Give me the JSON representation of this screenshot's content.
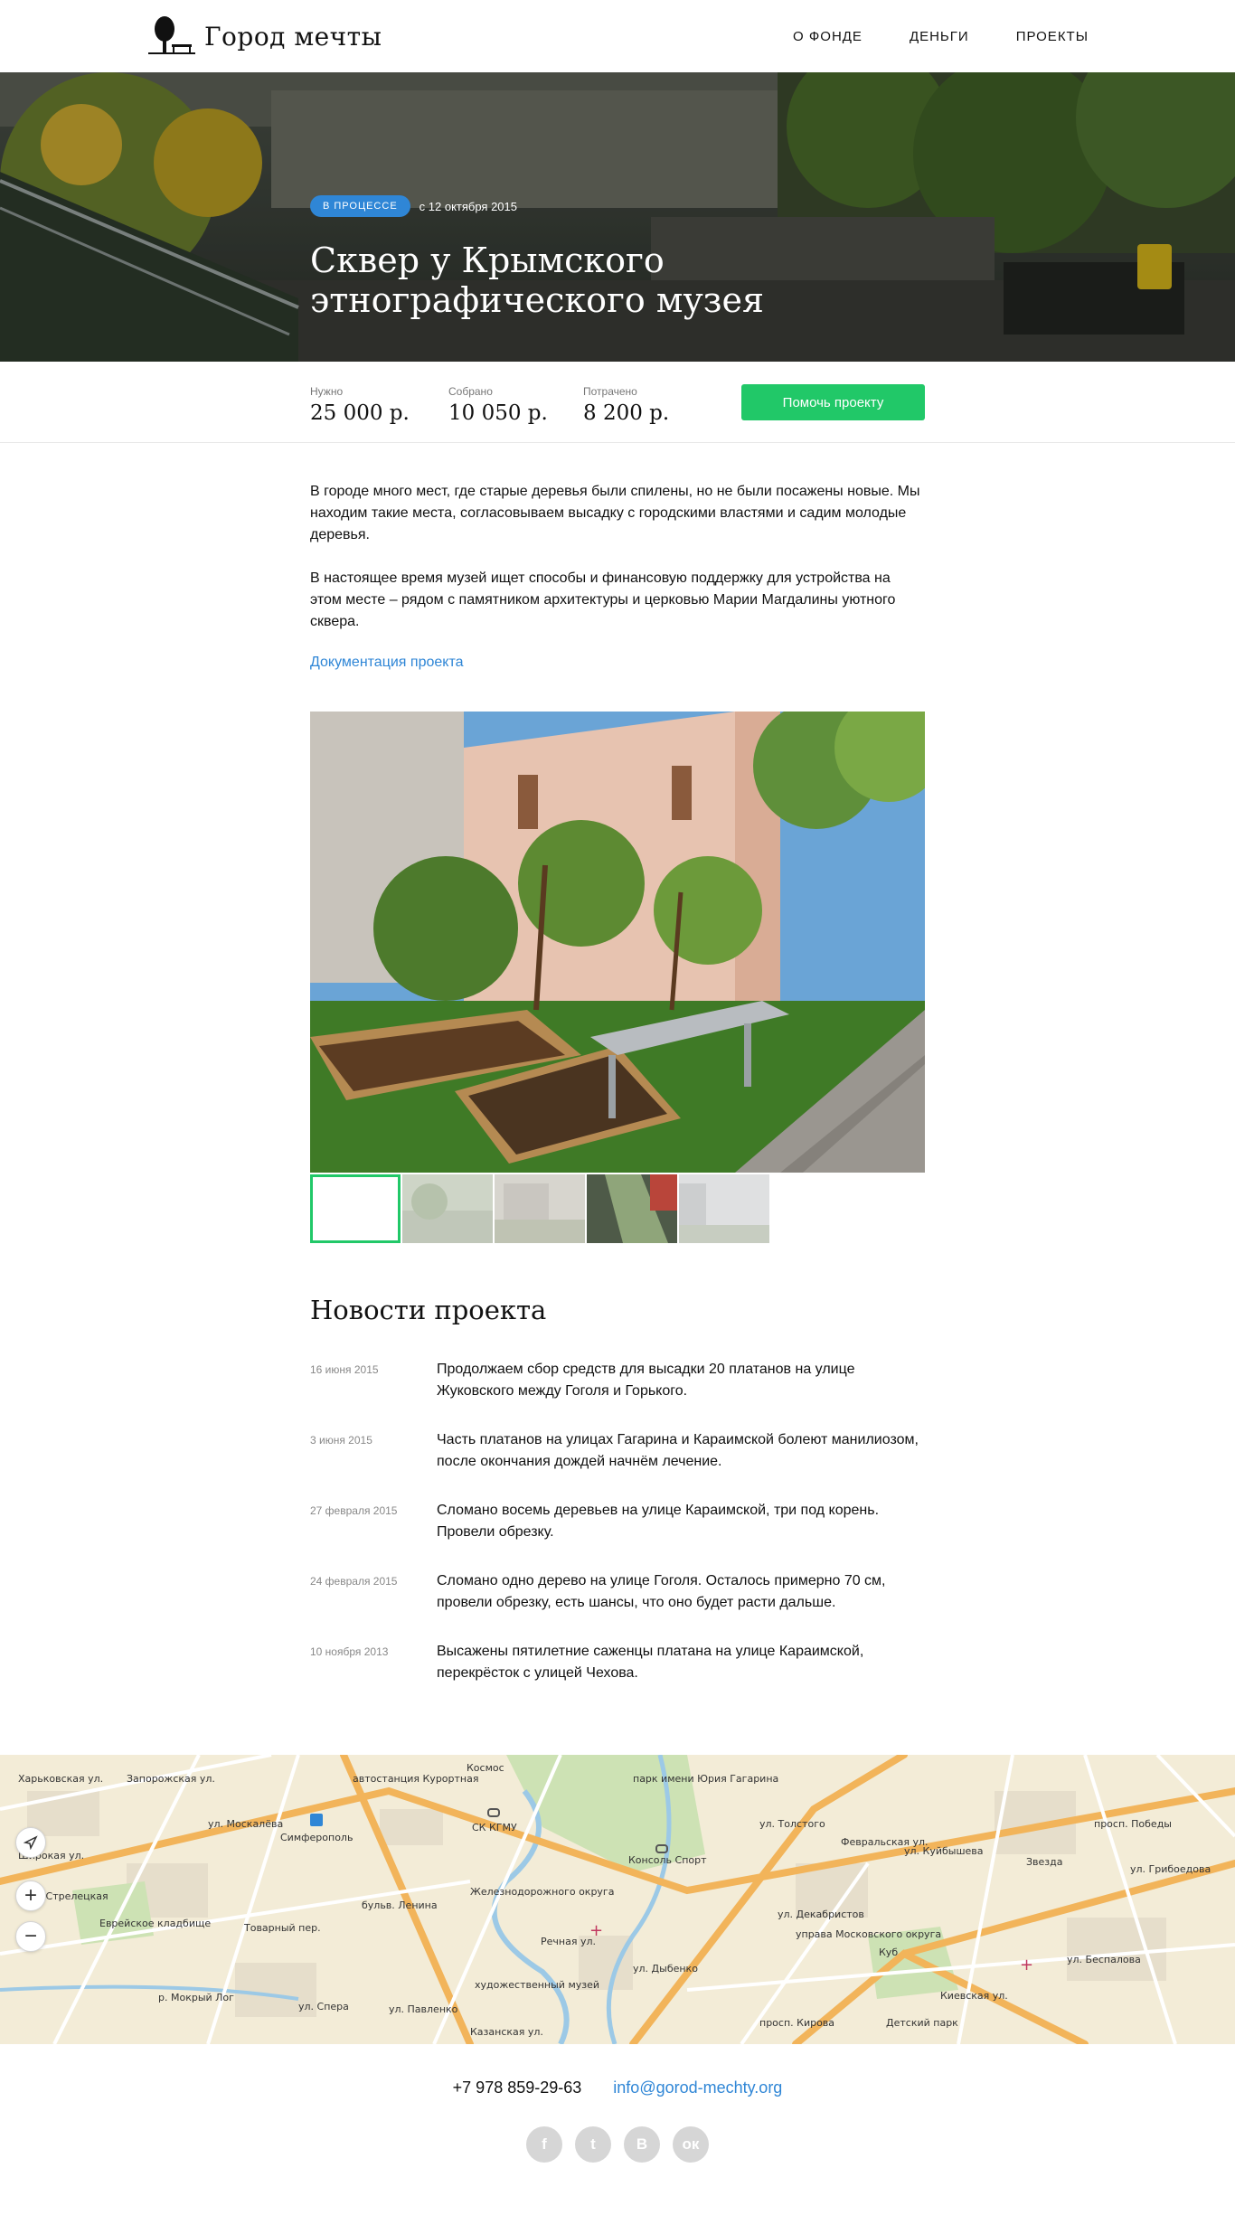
{
  "header": {
    "logo_text": "Город мечты",
    "nav": [
      "О ФОНДЕ",
      "ДЕНЬГИ",
      "ПРОЕКТЫ"
    ]
  },
  "hero": {
    "status_badge": "В ПРОЦЕССЕ",
    "date": "с 12 октября 2015",
    "title": "Сквер у Крымского этнографического музея"
  },
  "stats": {
    "needed_label": "Нужно",
    "needed_value": "25 000 р.",
    "collected_label": "Собрано",
    "collected_value": "10 050 р.",
    "spent_label": "Потрачено",
    "spent_value": "8 200 р.",
    "help_button": "Помочь проекту"
  },
  "description": {
    "paragraph_1": "В городе много мест, где старые деревья были спилены, но не были посажены новые. Мы находим такие места, согласовываем высадку с городскими властями и садим молодые деревья.",
    "paragraph_2": "В настоящее время музей ищет способы и финансовую поддержку для устройства на этом месте – рядом с памятником архитектуры и церковью Марии Магдалины уютного сквера.",
    "doc_link": "Документация проекта"
  },
  "gallery": {
    "thumbnail_count": 5,
    "active_index": 0
  },
  "news": {
    "title": "Новости проекта",
    "items": [
      {
        "date": "16 июня 2015",
        "text": "Продолжаем сбор средств для высадки 20 платанов на улице Жуковского между Гоголя и Горького."
      },
      {
        "date": "3 июня 2015",
        "text": "Часть платанов на улицах Гагарина и Караимской болеют манилиозом, после окончания дождей начнём лечение."
      },
      {
        "date": "27 февраля 2015",
        "text": "Сломано восемь деревьев на улице Караимской, три под корень. Провели обрезку."
      },
      {
        "date": "24 февраля 2015",
        "text": "Сломано одно дерево на улице Гоголя. Осталось примерно 70 см, провели обрезку, есть шансы, что оно будет расти дальше."
      },
      {
        "date": "10 ноября 2013",
        "text": "Высажены пятилетние саженцы платана на улице Караимской, перекрёсток с улицей Чехова."
      }
    ]
  },
  "map": {
    "labels": [
      "Харьковская ул.",
      "Запорожская ул.",
      "ул. Москалёва",
      "Симферополь",
      "автостанция Курортная",
      "Космос",
      "СК КГМУ",
      "парк имени Юрия Гагарина",
      "Консоль Спорт",
      "ул. Толстого",
      "Февральская ул.",
      "ул. Куйбышева",
      "просп. Победы",
      "ул. Грибоедова",
      "Звезда",
      "Еврейское кладбище",
      "бульв. Ленина",
      "Железнодорожного округа",
      "Речная ул.",
      "ул. Декабристов",
      "управа Московского округа",
      "Куб",
      "Киевская ул.",
      "ул. Беспалова",
      "ул. Дыбенко",
      "художественный музей",
      "р. Мокрый Лог",
      "ул. Павленко",
      "просп. Кирова",
      "Детский парк",
      "Широкая ул.",
      "ул. Стрелецкая",
      "Товарный пер.",
      "ул. Спера",
      "Казанская ул."
    ],
    "zoom_in": "+",
    "zoom_out": "−"
  },
  "footer": {
    "phone": "+7 978 859-29-63",
    "email": "info@gorod-mechty.org",
    "socials": [
      {
        "icon": "facebook-icon",
        "glyph": "f"
      },
      {
        "icon": "twitter-icon",
        "glyph": "t"
      },
      {
        "icon": "vk-icon",
        "glyph": "В"
      },
      {
        "icon": "odnoklassniki-icon",
        "glyph": "ок"
      }
    ]
  },
  "colors": {
    "accent_blue": "#2f86d6",
    "accent_green": "#21c868"
  }
}
